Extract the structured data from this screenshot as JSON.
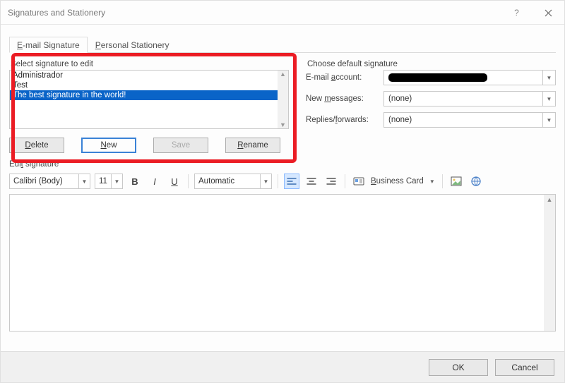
{
  "window": {
    "title": "Signatures and Stationery"
  },
  "tabs": {
    "email_signature": "E-mail Signature",
    "personal_stationery": "Personal Stationery"
  },
  "select_signature": {
    "label": "Select signature to edit",
    "items": [
      "Administrador",
      "Test",
      "The best signature in the world!"
    ],
    "buttons": {
      "delete": "Delete",
      "new": "New",
      "save": "Save",
      "rename": "Rename"
    }
  },
  "default_signature": {
    "label": "Choose default signature",
    "email_account_label": "E-mail account:",
    "email_account_value": "",
    "new_messages_label": "New messages:",
    "new_messages_value": "(none)",
    "replies_label": "Replies/forwards:",
    "replies_value": "(none)"
  },
  "edit": {
    "label": "Edit signature",
    "font": "Calibri (Body)",
    "size": "11",
    "color": "Automatic",
    "business_card": "Business Card"
  },
  "dialog": {
    "ok": "OK",
    "cancel": "Cancel"
  }
}
